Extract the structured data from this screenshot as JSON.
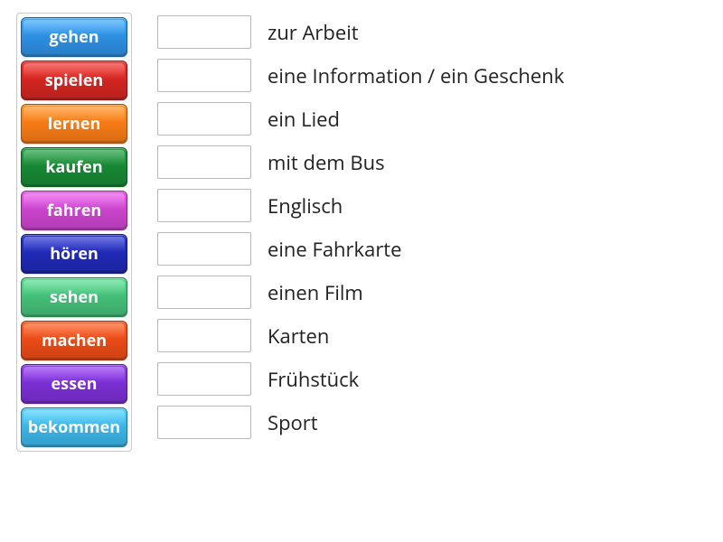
{
  "colors": {
    "blue": "#2e8ee0",
    "red": "#d12521",
    "orange": "#f57a16",
    "green_dark": "#178734",
    "magenta": "#c944cb",
    "indigo": "#1f29b4",
    "green_light": "#43bd77",
    "orange_red": "#e94a16",
    "purple": "#7a2fd1",
    "sky": "#3bb3e6"
  },
  "tiles": [
    {
      "label": "gehen",
      "colorKey": "blue"
    },
    {
      "label": "spielen",
      "colorKey": "red"
    },
    {
      "label": "lernen",
      "colorKey": "orange"
    },
    {
      "label": "kaufen",
      "colorKey": "green_dark"
    },
    {
      "label": "fahren",
      "colorKey": "magenta"
    },
    {
      "label": "hören",
      "colorKey": "indigo"
    },
    {
      "label": "sehen",
      "colorKey": "green_light"
    },
    {
      "label": "machen",
      "colorKey": "orange_red"
    },
    {
      "label": "essen",
      "colorKey": "purple"
    },
    {
      "label": "bekommen",
      "colorKey": "sky"
    }
  ],
  "rows": [
    {
      "phrase": "zur Arbeit"
    },
    {
      "phrase": "eine Information / ein Geschenk"
    },
    {
      "phrase": "ein Lied"
    },
    {
      "phrase": "mit dem Bus"
    },
    {
      "phrase": "Englisch"
    },
    {
      "phrase": "eine Fahrkarte"
    },
    {
      "phrase": "einen Film"
    },
    {
      "phrase": "Karten"
    },
    {
      "phrase": "Frühstück"
    },
    {
      "phrase": "Sport"
    }
  ]
}
